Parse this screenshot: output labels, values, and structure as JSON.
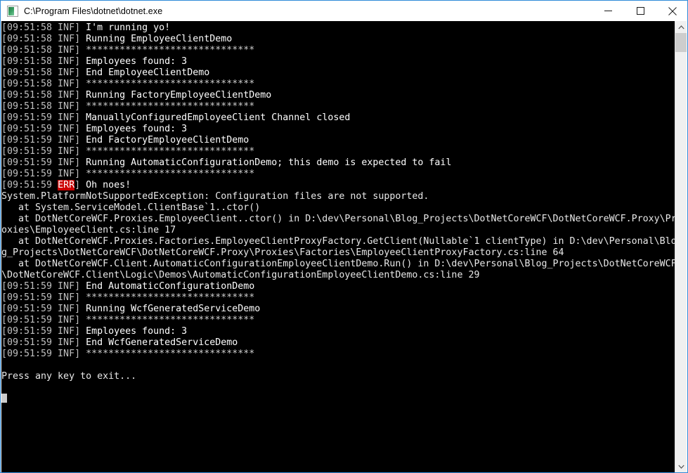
{
  "window": {
    "title": "C:\\Program Files\\dotnet\\dotnet.exe",
    "icon": "console-app-icon",
    "border_color": "#2e8ad8",
    "controls": {
      "minimize_label": "Minimize",
      "maximize_label": "Maximize",
      "close_label": "Close"
    }
  },
  "console": {
    "background_color": "#000000",
    "text_color": "#cccccc",
    "error_badge_color": "#cc0000",
    "prompt": "Press any key to exit...",
    "separator": "******************************",
    "lines": [
      {
        "kind": "log",
        "time": "[09:51:58 INF]",
        "level": "INF",
        "text": "I'm running yo!"
      },
      {
        "kind": "log",
        "time": "[09:51:58 INF]",
        "level": "INF",
        "text": "Running EmployeeClientDemo"
      },
      {
        "kind": "log",
        "time": "[09:51:58 INF]",
        "level": "INF",
        "text": "******************************"
      },
      {
        "kind": "log",
        "time": "[09:51:58 INF]",
        "level": "INF",
        "text": "Employees found: 3"
      },
      {
        "kind": "log",
        "time": "[09:51:58 INF]",
        "level": "INF",
        "text": "End EmployeeClientDemo"
      },
      {
        "kind": "log",
        "time": "[09:51:58 INF]",
        "level": "INF",
        "text": "******************************"
      },
      {
        "kind": "log",
        "time": "[09:51:58 INF]",
        "level": "INF",
        "text": "Running FactoryEmployeeClientDemo"
      },
      {
        "kind": "log",
        "time": "[09:51:58 INF]",
        "level": "INF",
        "text": "******************************"
      },
      {
        "kind": "log",
        "time": "[09:51:59 INF]",
        "level": "INF",
        "text": "ManuallyConfiguredEmployeeClient Channel closed"
      },
      {
        "kind": "log",
        "time": "[09:51:59 INF]",
        "level": "INF",
        "text": "Employees found: 3"
      },
      {
        "kind": "log",
        "time": "[09:51:59 INF]",
        "level": "INF",
        "text": "End FactoryEmployeeClientDemo"
      },
      {
        "kind": "log",
        "time": "[09:51:59 INF]",
        "level": "INF",
        "text": "******************************"
      },
      {
        "kind": "log",
        "time": "[09:51:59 INF]",
        "level": "INF",
        "text": "Running AutomaticConfigurationDemo; this demo is expected to fail"
      },
      {
        "kind": "log",
        "time": "[09:51:59 INF]",
        "level": "INF",
        "text": "******************************"
      },
      {
        "kind": "error",
        "time_prefix": "[09:51:59 ",
        "badge": "ERR",
        "time_suffix": "]",
        "text": " Oh noes!"
      },
      {
        "kind": "raw",
        "text": "System.PlatformNotSupportedException: Configuration files are not supported."
      },
      {
        "kind": "raw",
        "text": "   at System.ServiceModel.ClientBase`1..ctor()"
      },
      {
        "kind": "raw",
        "text": "   at DotNetCoreWCF.Proxies.EmployeeClient..ctor() in D:\\dev\\Personal\\Blog_Projects\\DotNetCoreWCF\\DotNetCoreWCF.Proxy\\Pr"
      },
      {
        "kind": "raw",
        "text": "oxies\\EmployeeClient.cs:line 17"
      },
      {
        "kind": "raw",
        "text": "   at DotNetCoreWCF.Proxies.Factories.EmployeeClientProxyFactory.GetClient(Nullable`1 clientType) in D:\\dev\\Personal\\Blo"
      },
      {
        "kind": "raw",
        "text": "g_Projects\\DotNetCoreWCF\\DotNetCoreWCF.Proxy\\Proxies\\Factories\\EmployeeClientProxyFactory.cs:line 64"
      },
      {
        "kind": "raw",
        "text": "   at DotNetCoreWCF.Client.AutomaticConfigurationEmployeeClientDemo.Run() in D:\\dev\\Personal\\Blog_Projects\\DotNetCoreWCF"
      },
      {
        "kind": "raw",
        "text": "\\DotNetCoreWCF.Client\\Logic\\Demos\\AutomaticConfigurationEmployeeClientDemo.cs:line 29"
      },
      {
        "kind": "log",
        "time": "[09:51:59 INF]",
        "level": "INF",
        "text": "End AutomaticConfigurationDemo"
      },
      {
        "kind": "log",
        "time": "[09:51:59 INF]",
        "level": "INF",
        "text": "******************************"
      },
      {
        "kind": "log",
        "time": "[09:51:59 INF]",
        "level": "INF",
        "text": "Running WcfGeneratedServiceDemo"
      },
      {
        "kind": "log",
        "time": "[09:51:59 INF]",
        "level": "INF",
        "text": "******************************"
      },
      {
        "kind": "log",
        "time": "[09:51:59 INF]",
        "level": "INF",
        "text": "Employees found: 3"
      },
      {
        "kind": "log",
        "time": "[09:51:59 INF]",
        "level": "INF",
        "text": "End WcfGeneratedServiceDemo"
      },
      {
        "kind": "log",
        "time": "[09:51:59 INF]",
        "level": "INF",
        "text": "******************************"
      },
      {
        "kind": "blank",
        "text": ""
      },
      {
        "kind": "raw",
        "text": "Press any key to exit..."
      },
      {
        "kind": "blank",
        "text": ""
      },
      {
        "kind": "cursor",
        "text": ""
      }
    ]
  },
  "scrollbar": {
    "up_arrow": "chevron-up-icon",
    "down_arrow": "chevron-down-icon",
    "thumb_color": "#cdcdcd"
  }
}
